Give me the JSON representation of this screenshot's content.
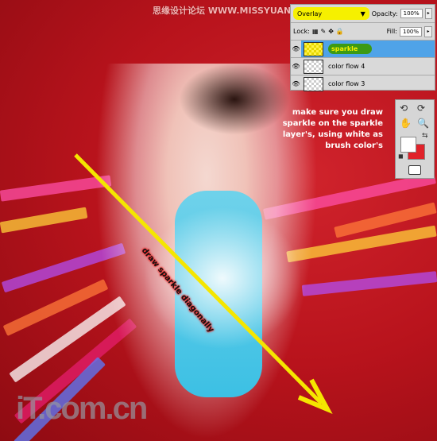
{
  "watermark_top": "思缘设计论坛 WWW.MISSYUAN.COM",
  "layers_panel": {
    "blend_mode": "Overlay",
    "opacity_label": "Opacity:",
    "opacity_value": "100%",
    "lock_label": "Lock:",
    "fill_label": "Fill:",
    "fill_value": "100%",
    "layers": [
      {
        "name": "sparkle",
        "selected": true
      },
      {
        "name": "color flow 4"
      },
      {
        "name": "color flow 3"
      }
    ]
  },
  "instruction": "make sure you draw sparkle on the sparkle layer's, using white as brush color's",
  "annotation": "draw sparkle diagonally",
  "tools_panel": {
    "foreground_color": "#ffffff",
    "background_color": "#e0222a"
  },
  "logo": "iT.com.cn",
  "colors": {
    "arrow": "#f5e600",
    "background": "#b8131c",
    "selection": "#4fa3e8"
  }
}
